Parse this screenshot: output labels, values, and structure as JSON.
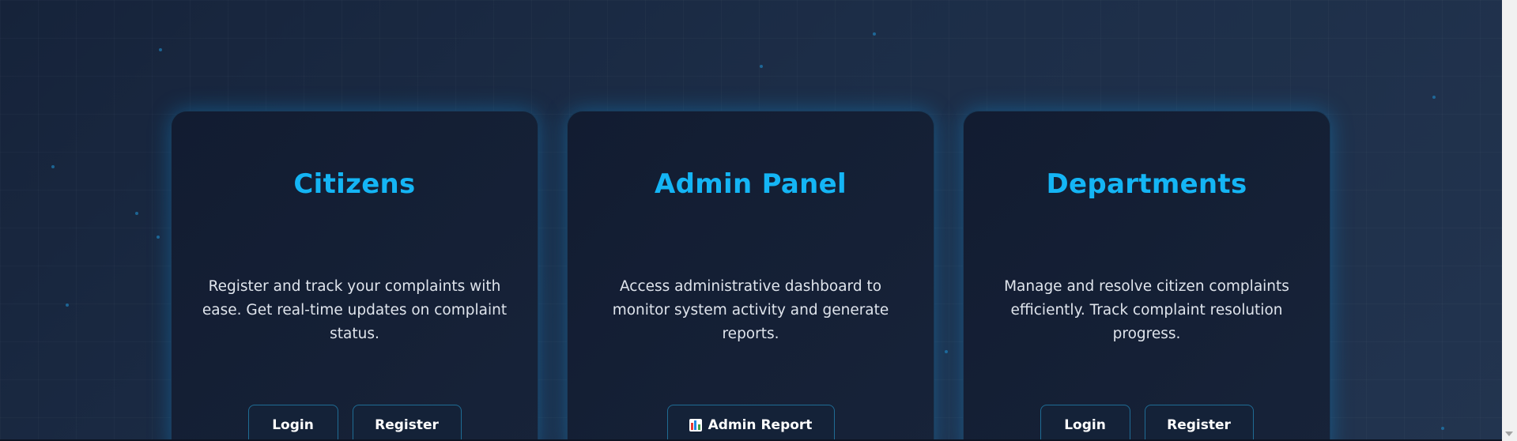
{
  "cards": [
    {
      "title": "Citizens",
      "description": "Register and track your complaints with ease. Get real-time updates on complaint status.",
      "login_label": "Login",
      "register_label": "Register"
    },
    {
      "title": "Admin Panel",
      "description": "Access administrative dashboard to monitor system activity and generate reports.",
      "admin_report_label": "Admin Report",
      "admin_report_icon": "bar-chart-icon"
    },
    {
      "title": "Departments",
      "description": "Manage and resolve citizen complaints efficiently. Track complaint resolution progress.",
      "login_label": "Login",
      "register_label": "Register"
    }
  ],
  "colors": {
    "accent": "#14b5f5",
    "card_bg": "#121c31",
    "page_bg": "#1c2d47",
    "button_border": "#1f6c94"
  }
}
